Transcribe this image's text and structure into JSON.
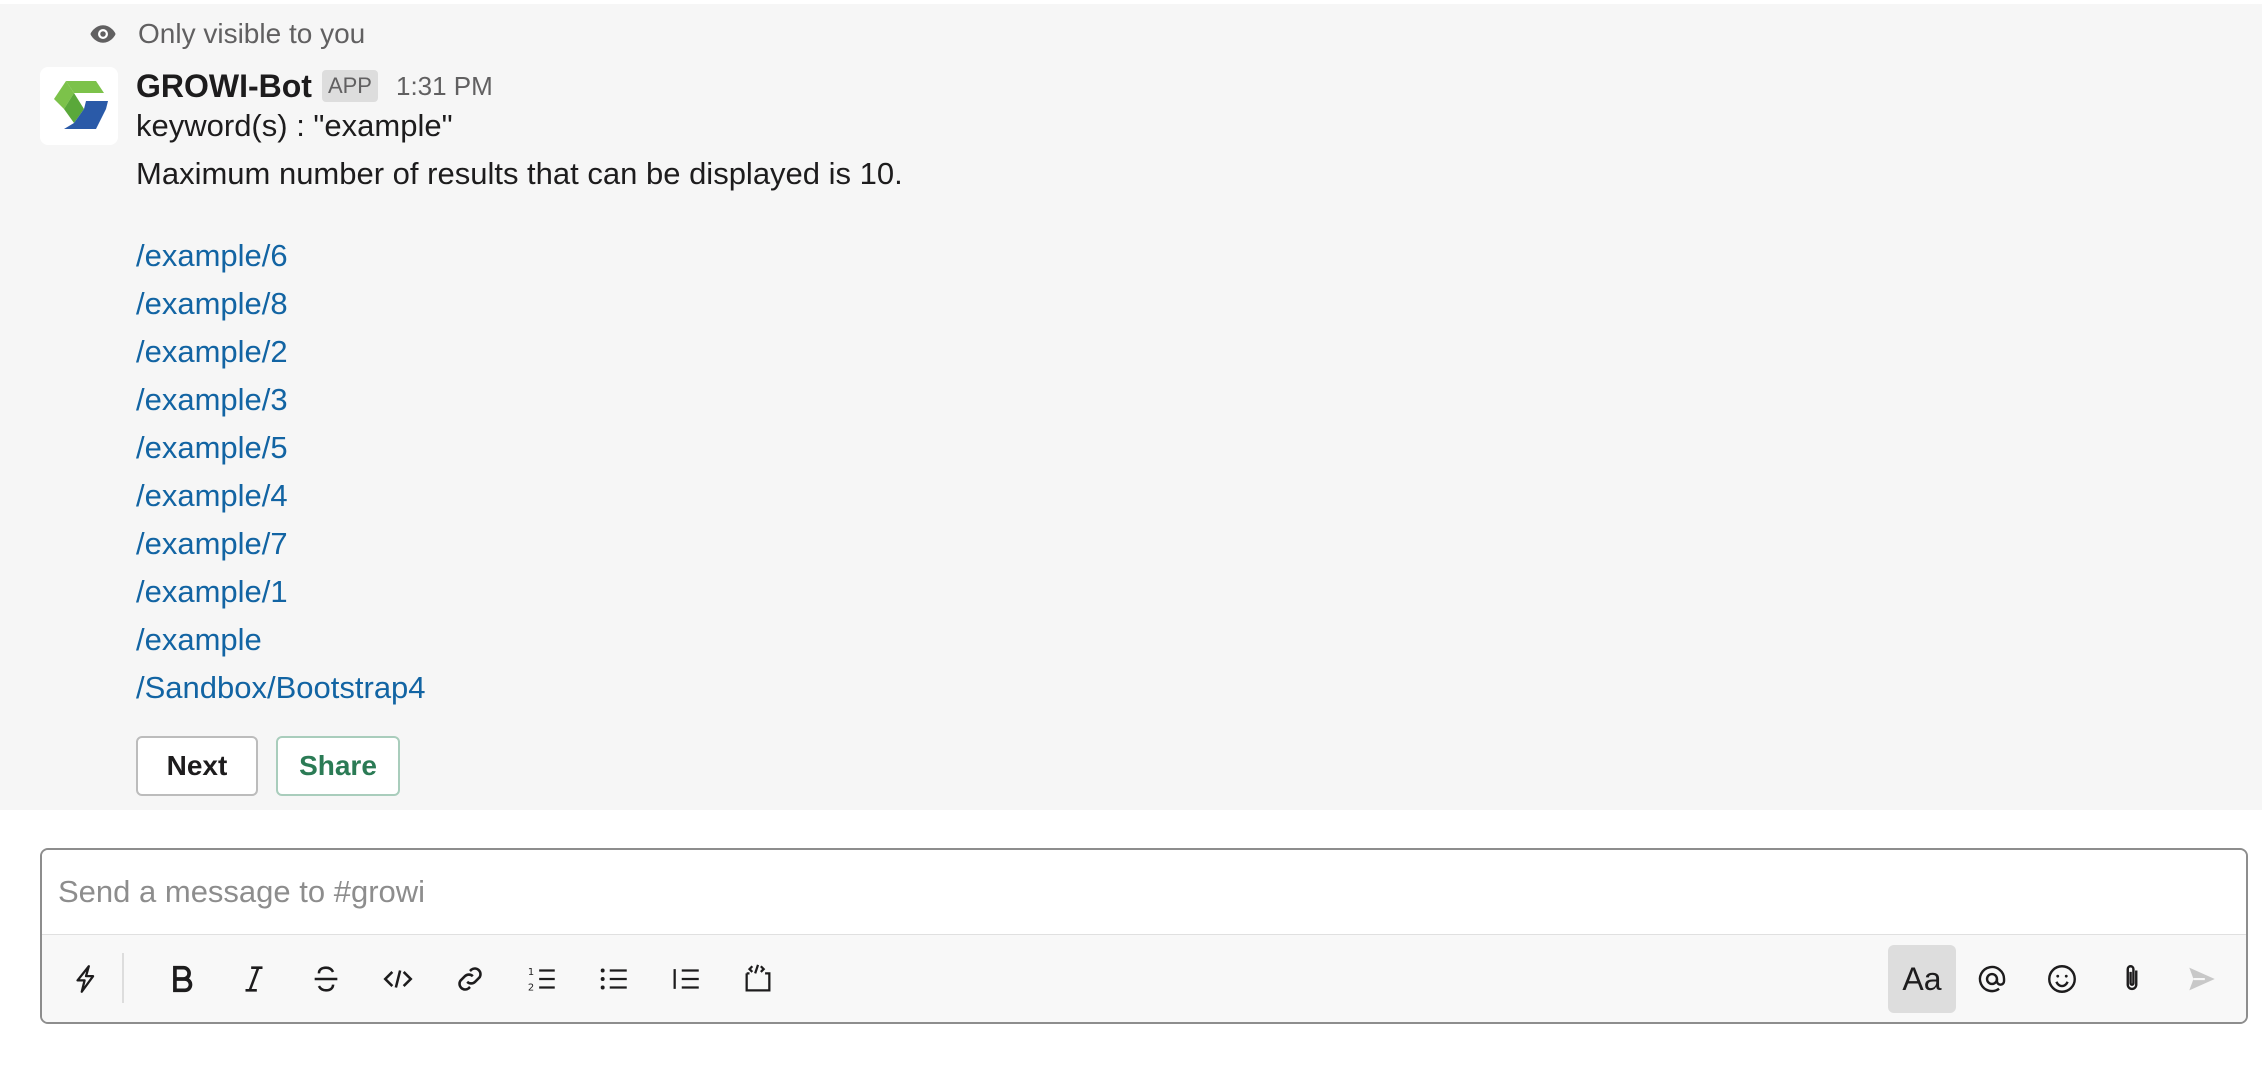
{
  "ephemeral_notice": "Only visible to you",
  "message": {
    "bot_name": "GROWI-Bot",
    "badge": "APP",
    "time": "1:31 PM",
    "keyword_line": "keyword(s) : \"example\"",
    "max_line": "Maximum number of results that can be displayed is 10.",
    "results": [
      "/example/6",
      "/example/8",
      "/example/2",
      "/example/3",
      "/example/5",
      "/example/4",
      "/example/7",
      "/example/1",
      "/example",
      "/Sandbox/Bootstrap4"
    ],
    "buttons": {
      "next": "Next",
      "share": "Share"
    }
  },
  "composer": {
    "placeholder": "Send a message to #growi",
    "format_label": "Aa"
  },
  "colors": {
    "link": "#1264a3",
    "share_text": "#2b7b55",
    "logo_green": "#7cc24a",
    "logo_blue": "#2a5aa8"
  },
  "icons": {
    "notice": "eye-icon",
    "toolbar": [
      "shortcuts-lightning-icon",
      "bold-icon",
      "italic-icon",
      "strikethrough-icon",
      "code-icon",
      "link-icon",
      "ordered-list-icon",
      "bulleted-list-icon",
      "blockquote-icon",
      "code-block-icon"
    ],
    "right": [
      "formatting-aa-icon",
      "mention-icon",
      "emoji-icon",
      "attachment-icon",
      "send-icon"
    ]
  }
}
